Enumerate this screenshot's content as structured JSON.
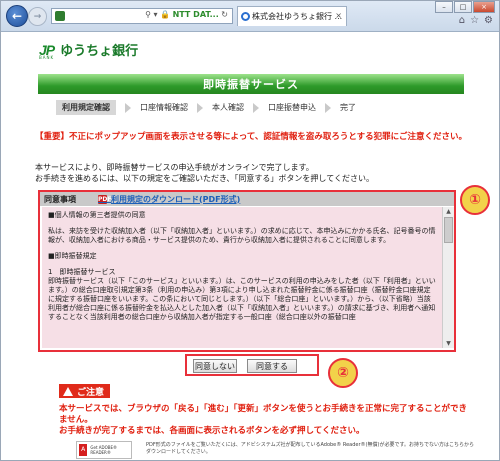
{
  "browser": {
    "address_text": "NTT DAT...",
    "tab_title": "株式会社ゆうちょ銀行",
    "back_icon": "back-arrow-icon",
    "forward_icon": "forward-arrow-icon"
  },
  "header": {
    "logo_mark": "JP",
    "logo_sub": "BANK",
    "bank_name": "ゆうちょ銀行"
  },
  "page_title": "即時振替サービス",
  "steps": [
    {
      "label": "利用規定確認",
      "active": true
    },
    {
      "label": "口座情報確認",
      "active": false
    },
    {
      "label": "本人確認",
      "active": false
    },
    {
      "label": "口座振替申込",
      "active": false
    },
    {
      "label": "完了",
      "active": false
    }
  ],
  "warning": "【重要】不正にポップアップ画面を表示させる等によって、認証情報を盗み取ろうとする犯罪にご注意ください。",
  "intro_lines": [
    "本サービスにより、即時振替サービスの申込手続がオンラインで完了します。",
    "お手続きを進めるには、以下の規定をご確認いただき、「同意する」ボタンを押してください。"
  ],
  "terms": {
    "heading": "同意事項",
    "download_link": "利用規定のダウンロード(PDF形式)",
    "paragraphs": [
      "■個人情報の第三者提供の同意",
      "私は、来訪を受けた収納加入者（以下「収納加入者」といいます。）の求めに応じて、本申込みにかかる氏名、記号番号の情報が、収納加入者における商品・サービス提供のため、貴行から収納加入者に提供されることに同意します。",
      "■即時振替規定",
      "1　即時振替サービス\n即時振替サービス（以下「このサービス」といいます。）は、このサービスの利用の申込みをした者（以下「利用者」といいます。）の総合口座取引規定第3条（利用の申込み）第3項により申し込まれた振替貯金に係る振替口座（振替貯金口座規定に規定する振替口座をいいます。この条において同じとします。）（以下「総合口座」といいます。）から、（以下省略）当該利用者が総合口座に係る振替貯金を払込人とした加入者（以下「収納加入者」といいます。）の請求に基づき、利用者へ通知することなく当該利用者の総合口座から収納加入者が指定する一般口座（総合口座以外の振替口座"
    ]
  },
  "buttons": {
    "disagree": "同意しない",
    "agree": "同意する"
  },
  "callouts": {
    "one": "①",
    "two": "②"
  },
  "caution": {
    "label": "ご注意",
    "lines": [
      "本サービスでは、ブラウザの「戻る」「進む」「更新」ボタンを使うとお手続きを正常に完了することができません。",
      "お手続きが完了するまでは、各画面に表示されるボタンを必ず押してください。"
    ]
  },
  "reader": {
    "label": "Get ADOBE® READER®",
    "note": "PDF形式のファイルをご覧いただくには、アドビシステムズ社が配布しているAdobe® Reader®(無償)が必要です。お持ちでない方はこちらからダウンロードしてください。"
  },
  "colors": {
    "brand_green": "#2e9a2a",
    "alert_red": "#e02010",
    "terms_bg": "#f6dfe6",
    "callout_yellow": "#f2d24a"
  }
}
